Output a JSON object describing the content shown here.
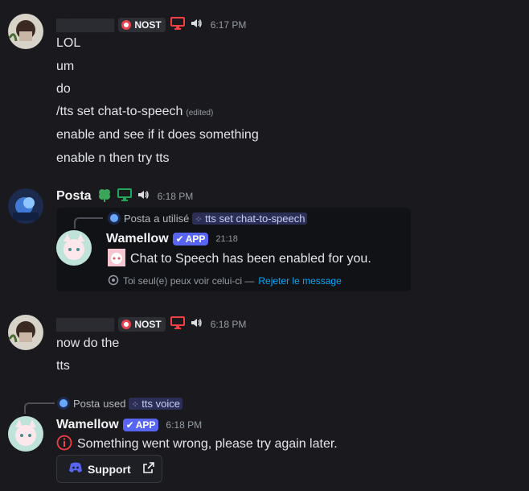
{
  "messages": {
    "m1": {
      "username_hidden": "████████",
      "tag": "NOST",
      "time": "6:17 PM",
      "lines": [
        "LOL",
        "um",
        "do",
        "/tts set chat-to-speech",
        "enable and see if it does something",
        "enable n then try tts"
      ],
      "edited": "(edited)"
    },
    "m2": {
      "username": "Posta",
      "time": "6:18 PM",
      "reply_user": "Posta",
      "reply_text": "a utilisé",
      "reply_command": "tts set chat-to-speech",
      "bot_name": "Wamellow",
      "bot_tag": "APP",
      "bot_time": "21:18",
      "bot_text": "Chat to Speech has been enabled for you.",
      "ephemeral_note": "Toi seul(e) peux voir celui-ci —",
      "ephemeral_link": "Rejeter le message"
    },
    "m3": {
      "username_hidden": "████████",
      "tag": "NOST",
      "time": "6:18 PM",
      "lines": [
        "now do the",
        "tts"
      ]
    },
    "m4": {
      "reply_user": "Posta",
      "reply_text": "used",
      "reply_command": "tts voice",
      "bot_name": "Wamellow",
      "bot_tag": "APP",
      "time": "6:18 PM",
      "error_text": "Something went wrong, please try again later.",
      "button_label": "Support"
    }
  },
  "colors": {
    "background": "#1a1a1e",
    "accent": "#5865f2",
    "link": "#00a8fc",
    "error": "#f23f43",
    "online": "#23a55a"
  },
  "icons": [
    "nost-icon",
    "desktop-icon",
    "speaker-icon",
    "clover-icon",
    "verified-check-icon",
    "info-icon",
    "eye-icon",
    "discord-icon",
    "external-link-icon",
    "slash-command-icon"
  ]
}
